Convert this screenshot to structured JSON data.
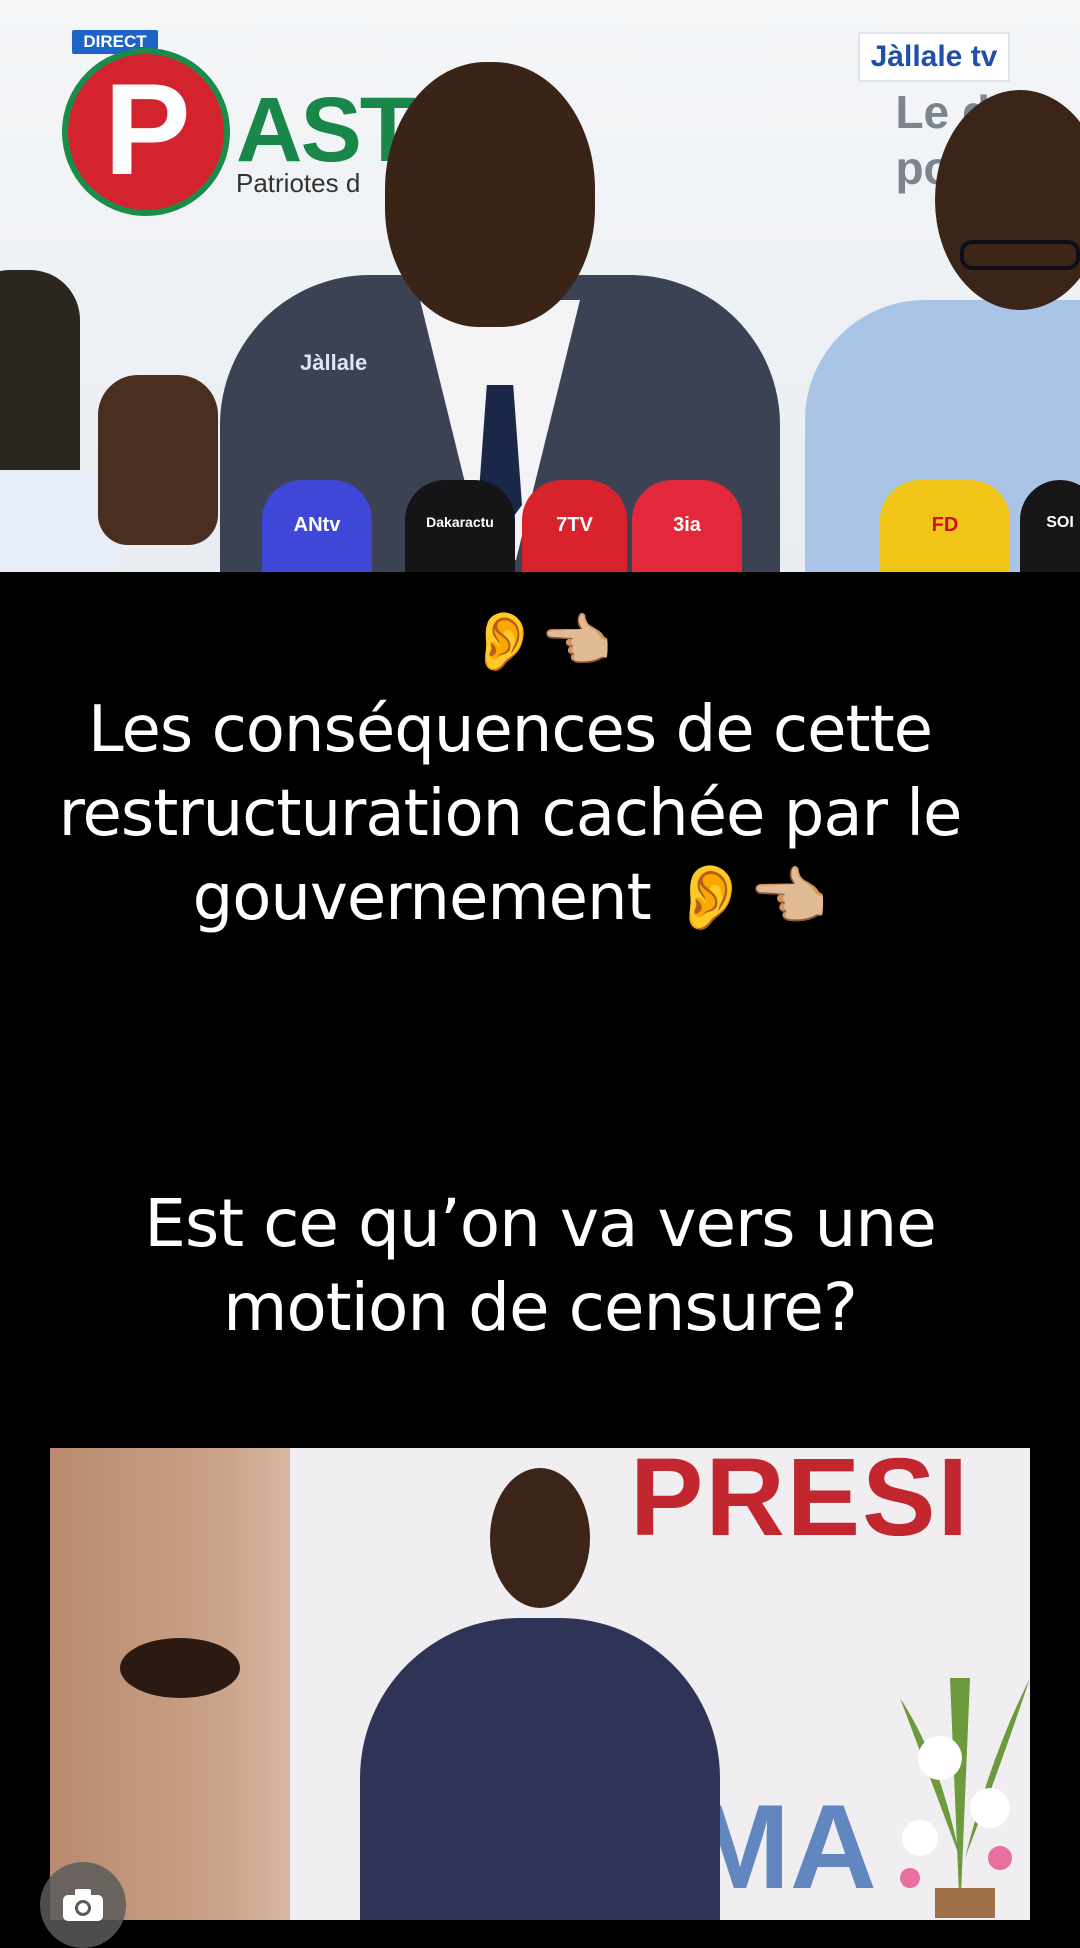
{
  "top_frame": {
    "direct_badge": "DIRECT",
    "logo_letter": "P",
    "logo_text": "AST",
    "logo_subtitle": "Patriotes d",
    "channel_logo": "Jàllale tv",
    "channel_tagline_1": "Le d",
    "channel_tagline_2": "pou",
    "mic_label": "Jàllale",
    "mics": [
      "ANtv",
      "Dakaractu",
      "7TV",
      "3ia",
      "FD",
      "SOI"
    ]
  },
  "captions": {
    "emoji_line": "👂👈🏼",
    "line_1": "Les conséquences de cette restructuration cachée par le gouvernement 👂👈🏼",
    "line_2": "Est ce qu’on va vers une motion de censure?"
  },
  "bottom_photo": {
    "banner_text": "PRESI",
    "banner_text_2": "MA"
  },
  "icons": {
    "camera": "camera-icon"
  },
  "colors": {
    "background": "#000000",
    "caption": "#ffffff",
    "direct_badge": "#1e63c8",
    "pastef_red": "#d3232f",
    "pastef_green": "#19864a"
  }
}
